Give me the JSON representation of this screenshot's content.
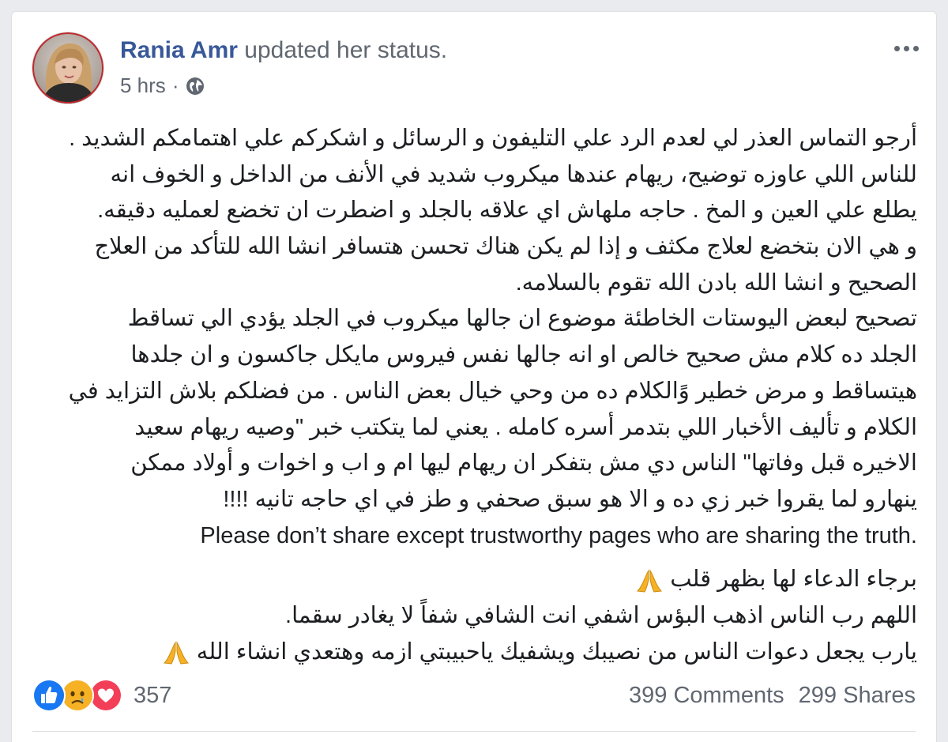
{
  "post": {
    "author": "Rania Amr",
    "action": "updated her status.",
    "time": "5 hrs",
    "separator": "·",
    "privacy_icon": "globe-icon",
    "more_icon": "more-options-icon",
    "body_lines": [
      "أرجو التماس العذر لي لعدم الرد علي التليفون و الرسائل و اشكركم علي اهتمامكم الشديد .",
      "للناس اللي عاوزه توضيح، ريهام عندها ميكروب شديد في الأنف من الداخل و الخوف انه",
      "يطلع علي العين و المخ . حاجه ملهاش اي علاقه بالجلد و اضطرت ان تخضع لعمليه دقيقه.",
      "و هي الان بتخضع لعلاج مكثف و إذا لم يكن هناك تحسن هتسافر انشا الله للتأكد من العلاج",
      "الصحيح و انشا الله بادن الله تقوم بالسلامه.",
      "تصحيح لبعض اليوستات الخاطئة موضوع ان جالها ميكروب في الجلد يؤدي الي تساقط",
      "الجلد ده كلام مش صحيح خالص او انه جالها نفس فيروس مايكل جاكسون و ان جلدها",
      "هيتساقط و مرض خطير وًالكلام ده من وحي خيال بعض الناس . من فضلكم بلاش التزايد في",
      "الكلام و تأليف الأخبار اللي بتدمر أسره كامله . يعني لما يتكتب خبر \"وصيه ريهام سعيد",
      "الاخيره قبل وفاتها\" الناس دي مش بتفكر ان ريهام ليها ام و اب و اخوات و أولاد ممكن",
      "ينهارو لما يقروا خبر زي ده و الا هو سبق صحفي و طز في اي حاجه تانيه !!!!"
    ],
    "english_line": "Please don’t share except trustworthy pages who are sharing the truth.",
    "prayer_lines": [
      "برجاء الدعاء لها بظهر قلب",
      "اللهم رب الناس اذهب البؤس اشفي انت الشافي شفاً لا يغادر سقما.",
      "يارب يجعل دعوات الناس من نصيبك ويشفيك ياحبيبتي ازمه وهتعدي انشاء الله"
    ],
    "prayer_emoji": "folded-hands-icon"
  },
  "footer": {
    "reaction_icons": [
      "like-icon",
      "sad-icon",
      "love-icon"
    ],
    "reaction_count": "357",
    "comments": "399 Comments",
    "shares": "299 Shares"
  },
  "colors": {
    "author": "#385898",
    "secondary_text": "#606770",
    "body_text": "#1c1e21",
    "like": "#1877f2",
    "love": "#f33e58",
    "sad": "#f7b125",
    "background": "#e9ebee"
  }
}
